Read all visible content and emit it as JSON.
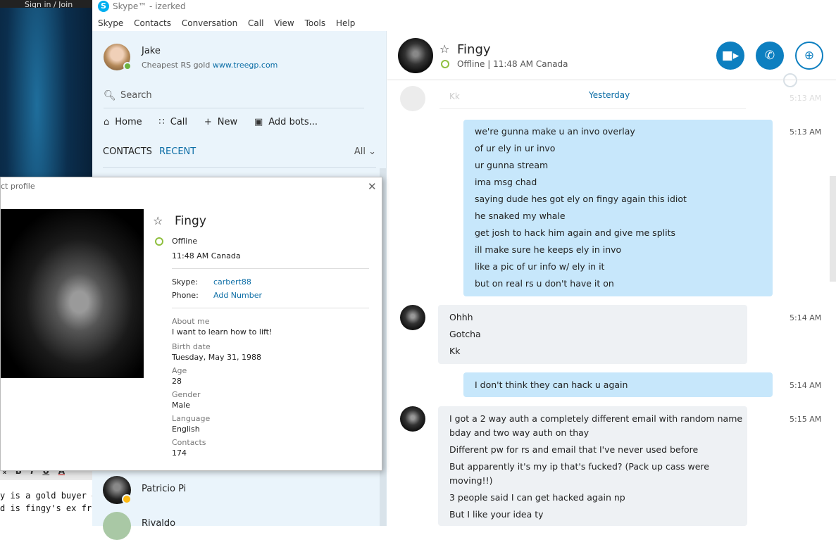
{
  "browser_tab": {
    "text": "Sign in / Join"
  },
  "window": {
    "title": "Skype™ - izerked",
    "logo_letter": "S"
  },
  "menu": [
    "Skype",
    "Contacts",
    "Conversation",
    "Call",
    "View",
    "Tools",
    "Help"
  ],
  "me": {
    "name": "Jake",
    "mood_text": "Cheapest RS gold ",
    "mood_link": "www.treegp.com"
  },
  "search": {
    "placeholder": "Search"
  },
  "nav": {
    "home": "Home",
    "call": "Call",
    "new": "New",
    "add_bots": "Add bots..."
  },
  "tabs": {
    "contacts": "CONTACTS",
    "recent": "RECENT",
    "filter": "All"
  },
  "contact_list": [
    {
      "name": "Patricio Pi"
    },
    {
      "name": "Rivaldo"
    }
  ],
  "doc": {
    "line1": "y is a gold buyer or",
    "line2": "d is fingy's ex friend"
  },
  "profile": {
    "title": "ct profile",
    "name": "Fingy",
    "status": "Offline",
    "local_time": "11:48 AM Canada",
    "skype_label": "Skype:",
    "skype_value": "carbert88",
    "phone_label": "Phone:",
    "phone_value": "Add Number",
    "fields": [
      {
        "label": "About me",
        "value": "I want to learn how to lift!"
      },
      {
        "label": "Birth date",
        "value": "Tuesday, May 31, 1988"
      },
      {
        "label": "Age",
        "value": "28"
      },
      {
        "label": "Gender",
        "value": "Male"
      },
      {
        "label": "Language",
        "value": "English"
      },
      {
        "label": "Contacts",
        "value": "174"
      }
    ]
  },
  "chat": {
    "name": "Fingy",
    "status": "Offline",
    "separator": "|",
    "local_time": "11:48 AM Canada",
    "faded_text": "Kk",
    "faded_time": "5:13 AM",
    "date_label": "Yesterday",
    "messages": [
      {
        "dir": "out",
        "time": "5:13 AM",
        "lines": [
          "we're gunna make u an invo overlay",
          "of ur ely in ur invo",
          "ur gunna stream",
          "ima msg chad",
          "saying dude hes got ely on fingy again this idiot",
          "he snaked my whale",
          "get josh to hack him again and give me splits",
          "ill make sure he keeps ely in invo",
          "like a pic of ur info w/ ely in it",
          "but on real rs u don't have it on"
        ]
      },
      {
        "dir": "in",
        "time": "5:14 AM",
        "lines": [
          "Ohhh",
          "Gotcha",
          "Kk"
        ]
      },
      {
        "dir": "out",
        "time": "5:14 AM",
        "lines": [
          "I don't think they can hack u again"
        ]
      },
      {
        "dir": "in",
        "time": "5:15 AM",
        "lines": [
          "I got a 2 way auth a completely different email with random name",
          "bday and two way auth on thay",
          "Different pw for rs and email that I've never used before",
          "But apparently it's my ip that's fucked? (Pack up cass were",
          "moving!!)",
          "3 people said I can get hacked again np",
          "But I like your idea ty"
        ]
      }
    ]
  },
  "icons": {
    "search": "search-icon",
    "home": "home-icon",
    "dialpad": "dialpad-icon",
    "plus": "plus-icon",
    "bot": "bot-icon",
    "star": "star-icon",
    "video": "video-call-icon",
    "phone": "phone-icon",
    "add_person": "add-person-icon",
    "close": "close-icon",
    "globe": "globe-icon"
  },
  "colors": {
    "accent": "#0d7fc0",
    "link": "#0d6ea6",
    "outgoing_bubble": "#c7e7fb",
    "incoming_bubble": "#eef1f4",
    "online": "#6cb33f",
    "away": "#fdb913"
  }
}
